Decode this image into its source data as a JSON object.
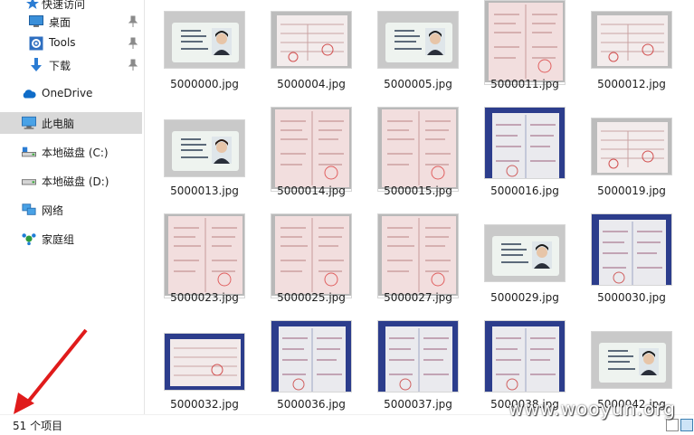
{
  "sidebar": {
    "items": [
      {
        "label": "快速访问",
        "icon": "star-icon"
      },
      {
        "label": "桌面",
        "icon": "desktop-icon"
      },
      {
        "label": "Tools",
        "icon": "gear-icon"
      },
      {
        "label": "下载",
        "icon": "download-icon"
      },
      {
        "label": "OneDrive",
        "icon": "cloud-icon"
      },
      {
        "label": "此电脑",
        "icon": "computer-icon"
      },
      {
        "label": "本地磁盘 (C:)",
        "icon": "drive-c-icon"
      },
      {
        "label": "本地磁盘 (D:)",
        "icon": "drive-d-icon"
      },
      {
        "label": "网络",
        "icon": "network-icon"
      },
      {
        "label": "家庭组",
        "icon": "homegroup-icon"
      }
    ]
  },
  "files": [
    {
      "name": "5000000.jpg",
      "kind": "id-card"
    },
    {
      "name": "5000004.jpg",
      "kind": "form"
    },
    {
      "name": "5000005.jpg",
      "kind": "id-card"
    },
    {
      "name": "5000011.jpg",
      "kind": "pink-doc"
    },
    {
      "name": "5000012.jpg",
      "kind": "form"
    },
    {
      "name": "5000013.jpg",
      "kind": "id-card-female"
    },
    {
      "name": "5000014.jpg",
      "kind": "pink-doc"
    },
    {
      "name": "5000015.jpg",
      "kind": "pink-doc"
    },
    {
      "name": "5000016.jpg",
      "kind": "blue-folder"
    },
    {
      "name": "5000019.jpg",
      "kind": "form"
    },
    {
      "name": "5000023.jpg",
      "kind": "pink-doc"
    },
    {
      "name": "5000025.jpg",
      "kind": "pink-doc"
    },
    {
      "name": "5000027.jpg",
      "kind": "pink-doc"
    },
    {
      "name": "5000029.jpg",
      "kind": "id-card"
    },
    {
      "name": "5000030.jpg",
      "kind": "blue-folder"
    },
    {
      "name": "5000032.jpg",
      "kind": "blue-form"
    },
    {
      "name": "5000036.jpg",
      "kind": "blue-folder"
    },
    {
      "name": "5000037.jpg",
      "kind": "blue-folder"
    },
    {
      "name": "5000038.jpg",
      "kind": "blue-folder"
    },
    {
      "name": "5000042.jpg",
      "kind": "id-card"
    }
  ],
  "status": {
    "count": "51 个项目",
    "watermark": "www.wooyun.org"
  }
}
